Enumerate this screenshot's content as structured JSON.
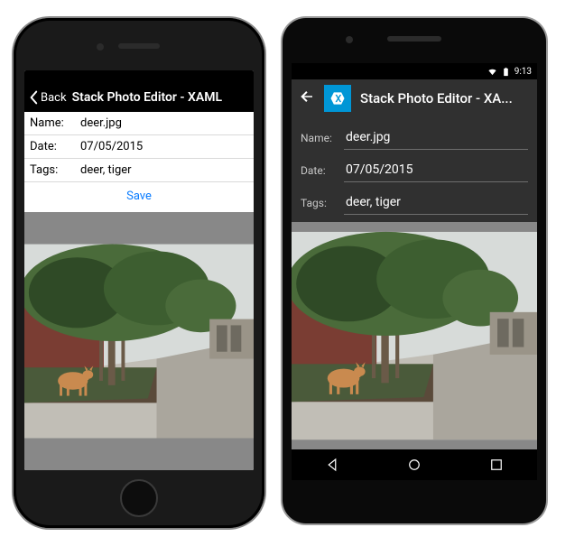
{
  "ios": {
    "nav": {
      "back_label": "Back",
      "title": "Stack Photo Editor - XAML"
    },
    "form": {
      "name_label": "Name:",
      "name_value": "deer.jpg",
      "date_label": "Date:",
      "date_value": "07/05/2015",
      "tags_label": "Tags:",
      "tags_value": "deer, tiger",
      "save_label": "Save"
    }
  },
  "android": {
    "status": {
      "time": "9:13"
    },
    "nav": {
      "title": "Stack Photo Editor - XA..."
    },
    "form": {
      "name_label": "Name:",
      "name_value": "deer.jpg",
      "date_label": "Date:",
      "date_value": "07/05/2015",
      "tags_label": "Tags:",
      "tags_value": "deer, tiger"
    }
  },
  "photo": {
    "subject": "deer under tree on sidewalk near brick building",
    "colors": {
      "sky": "#d7dbd9",
      "tree": "#4a6b3a",
      "tree_dark": "#2f4a26",
      "brick": "#7a3d33",
      "sidewalk": "#b8b5ae",
      "mulch": "#5a4a3a",
      "deer": "#c98a4f"
    }
  }
}
